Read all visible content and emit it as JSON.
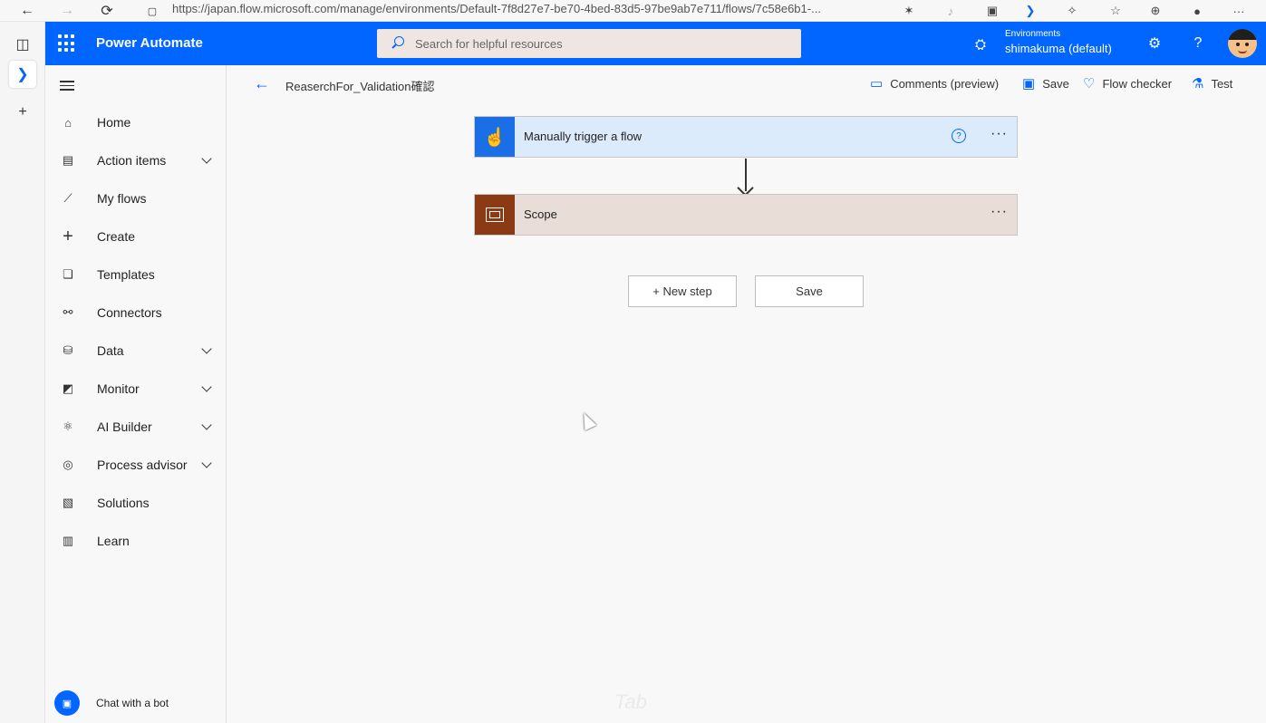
{
  "browser": {
    "url": "https://japan.flow.microsoft.com/manage/environments/Default-7f8d27e7-be70-4bed-83d5-97be9ab7e711/flows/7c58e6b1-..."
  },
  "header": {
    "app_title": "Power Automate",
    "search_placeholder": "Search for helpful resources",
    "env_label": "Environments",
    "env_name": "shimakuma (default)",
    "settings_glyph": "⚙",
    "help_glyph": "?"
  },
  "nav": {
    "items": [
      {
        "label": "Home",
        "icon": "home-icon",
        "glyph": "⌂",
        "chevron": false
      },
      {
        "label": "Action items",
        "icon": "clipboard-icon",
        "glyph": "▤",
        "chevron": true
      },
      {
        "label": "My flows",
        "icon": "flows-icon",
        "glyph": "⟋",
        "chevron": false
      },
      {
        "label": "Create",
        "icon": "plus-icon",
        "glyph": "+",
        "chevron": false
      },
      {
        "label": "Templates",
        "icon": "templates-icon",
        "glyph": "❏",
        "chevron": false
      },
      {
        "label": "Connectors",
        "icon": "connectors-icon",
        "glyph": "⚯",
        "chevron": false
      },
      {
        "label": "Data",
        "icon": "database-icon",
        "glyph": "⛁",
        "chevron": true
      },
      {
        "label": "Monitor",
        "icon": "monitor-icon",
        "glyph": "◩",
        "chevron": true
      },
      {
        "label": "AI Builder",
        "icon": "ai-builder-icon",
        "glyph": "⚛",
        "chevron": true
      },
      {
        "label": "Process advisor",
        "icon": "process-advisor-icon",
        "glyph": "◎",
        "chevron": true
      },
      {
        "label": "Solutions",
        "icon": "solutions-icon",
        "glyph": "▧",
        "chevron": false
      },
      {
        "label": "Learn",
        "icon": "book-icon",
        "glyph": "▥",
        "chevron": false
      }
    ],
    "chat_label": "Chat with a bot"
  },
  "command_bar": {
    "flow_name": "ReaserchFor_Validation確認",
    "comments_label": "Comments (preview)",
    "save_label": "Save",
    "checker_label": "Flow checker",
    "test_label": "Test"
  },
  "canvas": {
    "trigger_title": "Manually trigger a flow",
    "scope_title": "Scope",
    "new_step_label": "+ New step",
    "save_button_label": "Save",
    "dots": "···"
  },
  "colors": {
    "brand": "#0066ff",
    "trigger_bg": "#dcebfc",
    "trigger_icon_bg": "#1a6fe6",
    "scope_bg": "#e8ddd7",
    "scope_icon_bg": "#8b3a14"
  },
  "overlay": {
    "watermark": "Tab"
  }
}
